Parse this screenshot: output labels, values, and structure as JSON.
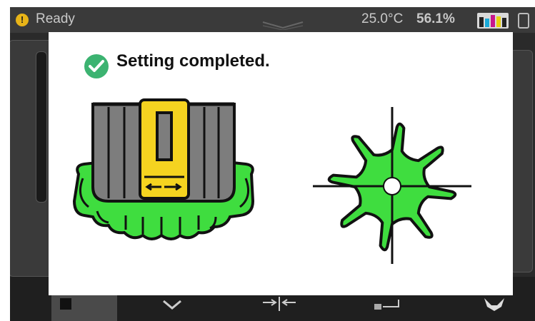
{
  "status": {
    "state_text": "Ready",
    "temperature": "25.0°C",
    "humidity": "56.1%",
    "alert_icon": "exclamation-icon",
    "ink_icon": "ink-levels-icon"
  },
  "dialog": {
    "title": "Setting completed.",
    "title_icon": "check-circle-icon",
    "illustrations": [
      "nozzle-cap-alignment-illustration",
      "gear-crosshair-illustration"
    ]
  },
  "bottom_nav": {
    "icons": [
      "square-icon",
      "chevron-down-icon",
      "arrows-inward-icon",
      "tray-icon",
      "wrench-icon"
    ],
    "active_index": 0
  },
  "colors": {
    "accent_green": "#3fdd3f",
    "check_green": "#3cb371",
    "label_yellow": "#f5d320",
    "alert_yellow": "#e8b418"
  }
}
